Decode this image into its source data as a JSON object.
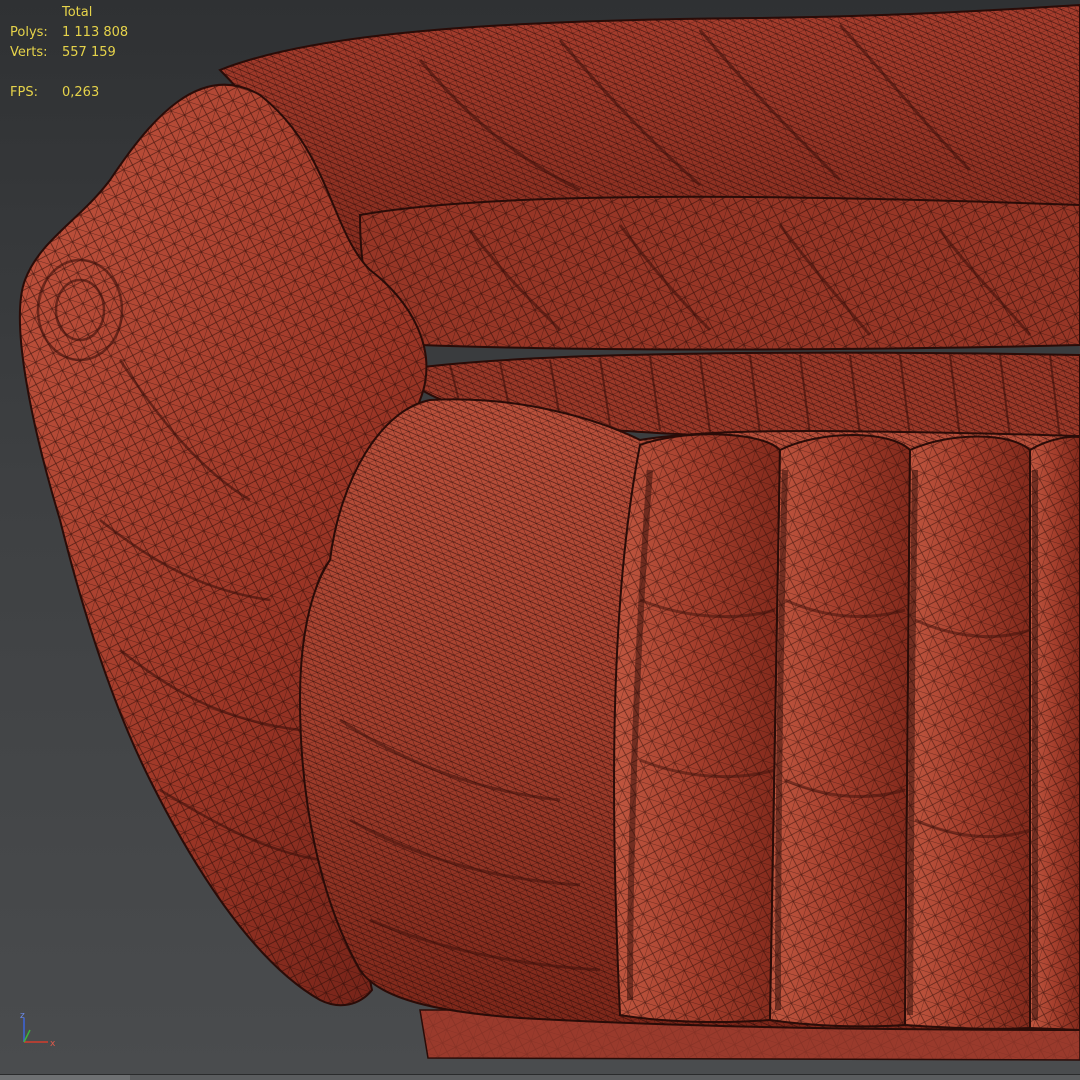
{
  "stats": {
    "header": "Total",
    "polys_label": "Polys:",
    "polys_value": "1 113 808",
    "verts_label": "Verts:",
    "verts_value": "557 159",
    "fps_label": "FPS:",
    "fps_value": "0,263"
  },
  "axis": {
    "z": "z",
    "x": "x"
  },
  "colors": {
    "background": "#3b3d3f",
    "mesh_fill": "#a83c2c",
    "wire": "#2a0c08",
    "stats_text": "#e6d34a",
    "axis_x": "#d23c2c",
    "axis_y": "#3cb43c",
    "axis_z": "#3c64dc"
  },
  "icons": {
    "axis": "axis-tripod-icon"
  }
}
